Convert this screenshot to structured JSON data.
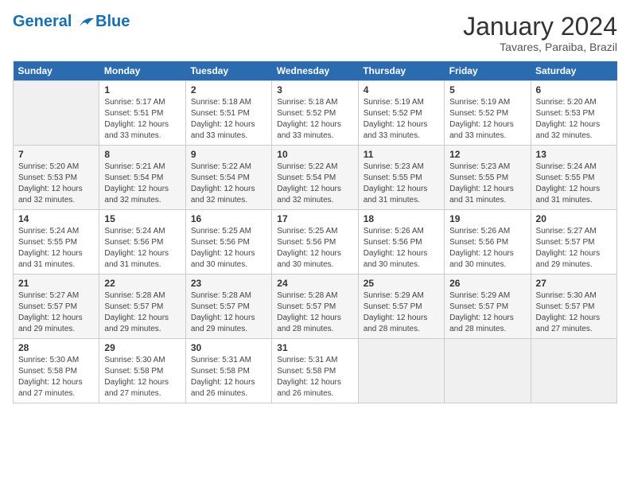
{
  "header": {
    "logo_line1": "General",
    "logo_line2": "Blue",
    "month": "January 2024",
    "location": "Tavares, Paraiba, Brazil"
  },
  "days_of_week": [
    "Sunday",
    "Monday",
    "Tuesday",
    "Wednesday",
    "Thursday",
    "Friday",
    "Saturday"
  ],
  "weeks": [
    [
      {
        "day": "",
        "info": ""
      },
      {
        "day": "1",
        "info": "Sunrise: 5:17 AM\nSunset: 5:51 PM\nDaylight: 12 hours\nand 33 minutes."
      },
      {
        "day": "2",
        "info": "Sunrise: 5:18 AM\nSunset: 5:51 PM\nDaylight: 12 hours\nand 33 minutes."
      },
      {
        "day": "3",
        "info": "Sunrise: 5:18 AM\nSunset: 5:52 PM\nDaylight: 12 hours\nand 33 minutes."
      },
      {
        "day": "4",
        "info": "Sunrise: 5:19 AM\nSunset: 5:52 PM\nDaylight: 12 hours\nand 33 minutes."
      },
      {
        "day": "5",
        "info": "Sunrise: 5:19 AM\nSunset: 5:52 PM\nDaylight: 12 hours\nand 33 minutes."
      },
      {
        "day": "6",
        "info": "Sunrise: 5:20 AM\nSunset: 5:53 PM\nDaylight: 12 hours\nand 32 minutes."
      }
    ],
    [
      {
        "day": "7",
        "info": "Sunrise: 5:20 AM\nSunset: 5:53 PM\nDaylight: 12 hours\nand 32 minutes."
      },
      {
        "day": "8",
        "info": "Sunrise: 5:21 AM\nSunset: 5:54 PM\nDaylight: 12 hours\nand 32 minutes."
      },
      {
        "day": "9",
        "info": "Sunrise: 5:22 AM\nSunset: 5:54 PM\nDaylight: 12 hours\nand 32 minutes."
      },
      {
        "day": "10",
        "info": "Sunrise: 5:22 AM\nSunset: 5:54 PM\nDaylight: 12 hours\nand 32 minutes."
      },
      {
        "day": "11",
        "info": "Sunrise: 5:23 AM\nSunset: 5:55 PM\nDaylight: 12 hours\nand 31 minutes."
      },
      {
        "day": "12",
        "info": "Sunrise: 5:23 AM\nSunset: 5:55 PM\nDaylight: 12 hours\nand 31 minutes."
      },
      {
        "day": "13",
        "info": "Sunrise: 5:24 AM\nSunset: 5:55 PM\nDaylight: 12 hours\nand 31 minutes."
      }
    ],
    [
      {
        "day": "14",
        "info": "Sunrise: 5:24 AM\nSunset: 5:55 PM\nDaylight: 12 hours\nand 31 minutes."
      },
      {
        "day": "15",
        "info": "Sunrise: 5:24 AM\nSunset: 5:56 PM\nDaylight: 12 hours\nand 31 minutes."
      },
      {
        "day": "16",
        "info": "Sunrise: 5:25 AM\nSunset: 5:56 PM\nDaylight: 12 hours\nand 30 minutes."
      },
      {
        "day": "17",
        "info": "Sunrise: 5:25 AM\nSunset: 5:56 PM\nDaylight: 12 hours\nand 30 minutes."
      },
      {
        "day": "18",
        "info": "Sunrise: 5:26 AM\nSunset: 5:56 PM\nDaylight: 12 hours\nand 30 minutes."
      },
      {
        "day": "19",
        "info": "Sunrise: 5:26 AM\nSunset: 5:56 PM\nDaylight: 12 hours\nand 30 minutes."
      },
      {
        "day": "20",
        "info": "Sunrise: 5:27 AM\nSunset: 5:57 PM\nDaylight: 12 hours\nand 29 minutes."
      }
    ],
    [
      {
        "day": "21",
        "info": "Sunrise: 5:27 AM\nSunset: 5:57 PM\nDaylight: 12 hours\nand 29 minutes."
      },
      {
        "day": "22",
        "info": "Sunrise: 5:28 AM\nSunset: 5:57 PM\nDaylight: 12 hours\nand 29 minutes."
      },
      {
        "day": "23",
        "info": "Sunrise: 5:28 AM\nSunset: 5:57 PM\nDaylight: 12 hours\nand 29 minutes."
      },
      {
        "day": "24",
        "info": "Sunrise: 5:28 AM\nSunset: 5:57 PM\nDaylight: 12 hours\nand 28 minutes."
      },
      {
        "day": "25",
        "info": "Sunrise: 5:29 AM\nSunset: 5:57 PM\nDaylight: 12 hours\nand 28 minutes."
      },
      {
        "day": "26",
        "info": "Sunrise: 5:29 AM\nSunset: 5:57 PM\nDaylight: 12 hours\nand 28 minutes."
      },
      {
        "day": "27",
        "info": "Sunrise: 5:30 AM\nSunset: 5:57 PM\nDaylight: 12 hours\nand 27 minutes."
      }
    ],
    [
      {
        "day": "28",
        "info": "Sunrise: 5:30 AM\nSunset: 5:58 PM\nDaylight: 12 hours\nand 27 minutes."
      },
      {
        "day": "29",
        "info": "Sunrise: 5:30 AM\nSunset: 5:58 PM\nDaylight: 12 hours\nand 27 minutes."
      },
      {
        "day": "30",
        "info": "Sunrise: 5:31 AM\nSunset: 5:58 PM\nDaylight: 12 hours\nand 26 minutes."
      },
      {
        "day": "31",
        "info": "Sunrise: 5:31 AM\nSunset: 5:58 PM\nDaylight: 12 hours\nand 26 minutes."
      },
      {
        "day": "",
        "info": ""
      },
      {
        "day": "",
        "info": ""
      },
      {
        "day": "",
        "info": ""
      }
    ]
  ]
}
